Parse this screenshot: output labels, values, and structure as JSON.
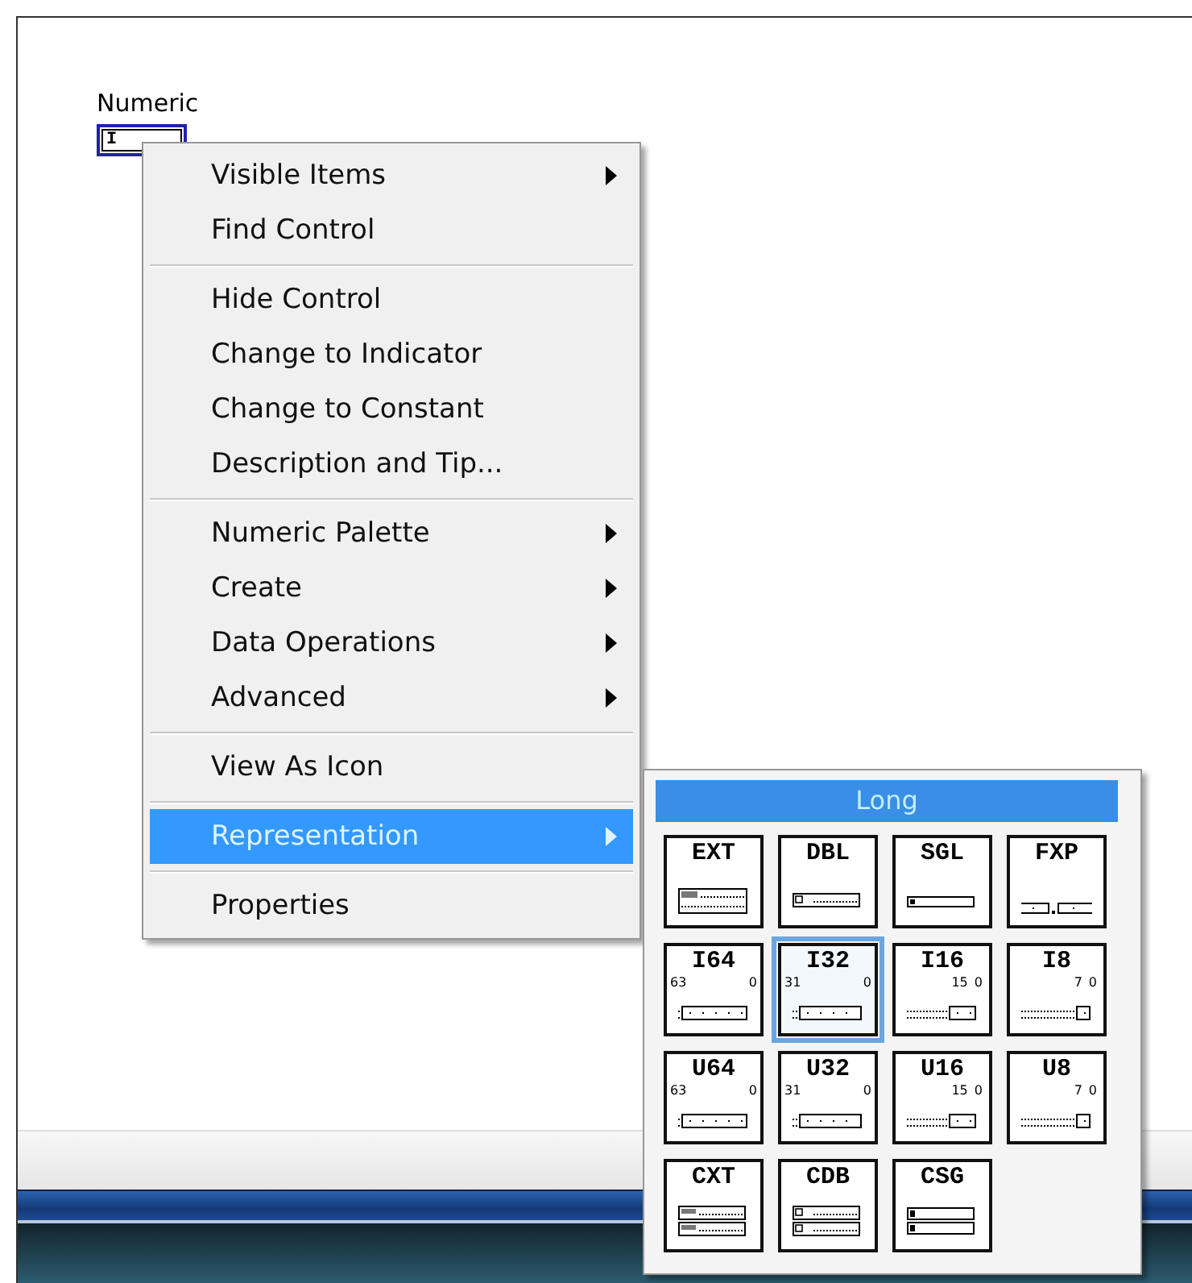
{
  "canvas": {
    "label": "Numeric",
    "control_text": "I"
  },
  "context_menu": {
    "groups": [
      [
        {
          "label": "Visible Items",
          "submenu": true,
          "selected": false
        },
        {
          "label": "Find Control",
          "submenu": false,
          "selected": false
        }
      ],
      [
        {
          "label": "Hide Control",
          "submenu": false,
          "selected": false
        },
        {
          "label": "Change to Indicator",
          "submenu": false,
          "selected": false
        },
        {
          "label": "Change to Constant",
          "submenu": false,
          "selected": false
        },
        {
          "label": "Description and Tip...",
          "submenu": false,
          "selected": false
        }
      ],
      [
        {
          "label": "Numeric Palette",
          "submenu": true,
          "selected": false
        },
        {
          "label": "Create",
          "submenu": true,
          "selected": false
        },
        {
          "label": "Data Operations",
          "submenu": true,
          "selected": false
        },
        {
          "label": "Advanced",
          "submenu": true,
          "selected": false
        }
      ],
      [
        {
          "label": "View As Icon",
          "submenu": false,
          "selected": false
        }
      ],
      [
        {
          "label": "Representation",
          "submenu": true,
          "selected": true
        }
      ],
      [
        {
          "label": "Properties",
          "submenu": false,
          "selected": false
        }
      ]
    ]
  },
  "representation_palette": {
    "title": "Long",
    "items": [
      {
        "label": "EXT",
        "kind": "extended",
        "selected": false
      },
      {
        "label": "DBL",
        "kind": "double",
        "selected": false
      },
      {
        "label": "SGL",
        "kind": "single",
        "selected": false
      },
      {
        "label": "FXP",
        "kind": "fixed",
        "selected": false
      },
      {
        "label": "I64",
        "kind": "int64",
        "msb": "63",
        "lsb": "0",
        "selected": false
      },
      {
        "label": "I32",
        "kind": "int32",
        "msb": "31",
        "lsb": "0",
        "selected": true
      },
      {
        "label": "I16",
        "kind": "int16",
        "msb": "15",
        "lsb": "0",
        "selected": false
      },
      {
        "label": "I8",
        "kind": "int8",
        "msb": "7",
        "lsb": "0",
        "selected": false
      },
      {
        "label": "U64",
        "kind": "int64",
        "msb": "63",
        "lsb": "0",
        "selected": false
      },
      {
        "label": "U32",
        "kind": "int32",
        "msb": "31",
        "lsb": "0",
        "selected": false
      },
      {
        "label": "U16",
        "kind": "int16",
        "msb": "15",
        "lsb": "0",
        "selected": false
      },
      {
        "label": "U8",
        "kind": "int8",
        "msb": "7",
        "lsb": "0",
        "selected": false
      },
      {
        "label": "CXT",
        "kind": "complex-extended",
        "selected": false
      },
      {
        "label": "CDB",
        "kind": "complex-double",
        "selected": false
      },
      {
        "label": "CSG",
        "kind": "complex-single",
        "selected": false
      }
    ]
  }
}
